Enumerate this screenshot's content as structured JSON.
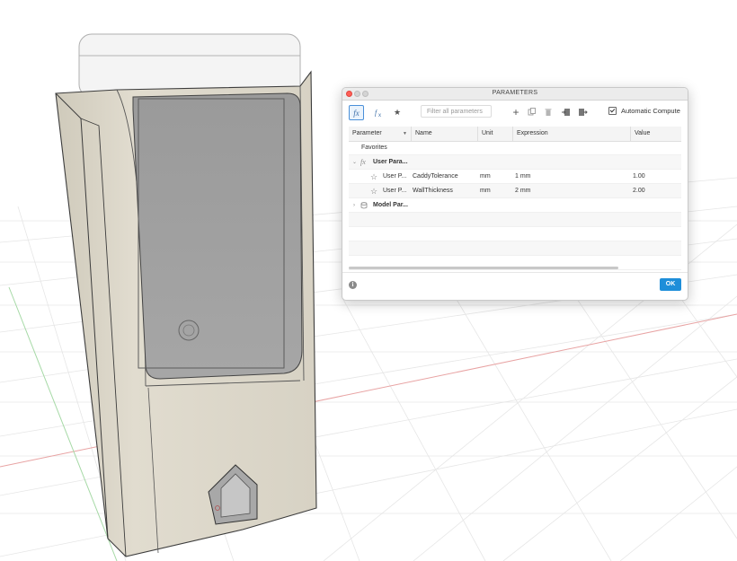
{
  "dialog": {
    "title": "PARAMETERS",
    "toolbar": {
      "filter_placeholder": "Filter all parameters",
      "auto_compute_label": "Automatic Compute",
      "auto_compute_checked": true
    },
    "columns": [
      "Parameter",
      "Name",
      "Unit",
      "Expression",
      "Value"
    ],
    "groups": {
      "favorites": "Favorites",
      "user_params": "User Para...",
      "model_params": "Model Par..."
    },
    "rows": [
      {
        "parameter": "User P...",
        "name": "CaddyTolerance",
        "unit": "mm",
        "expression": "1 mm",
        "value": "1.00"
      },
      {
        "parameter": "User P...",
        "name": "WallThickness",
        "unit": "mm",
        "expression": "2 mm",
        "value": "2.00"
      }
    ],
    "ok_label": "OK",
    "info_label": "i"
  },
  "colors": {
    "accent": "#1e8ed9",
    "model_body": "#dcd7c8",
    "grid_line": "#e4e4e4"
  },
  "icons": {
    "fx": "fx",
    "star": "★",
    "star_outline": "☆",
    "plus": "+"
  }
}
